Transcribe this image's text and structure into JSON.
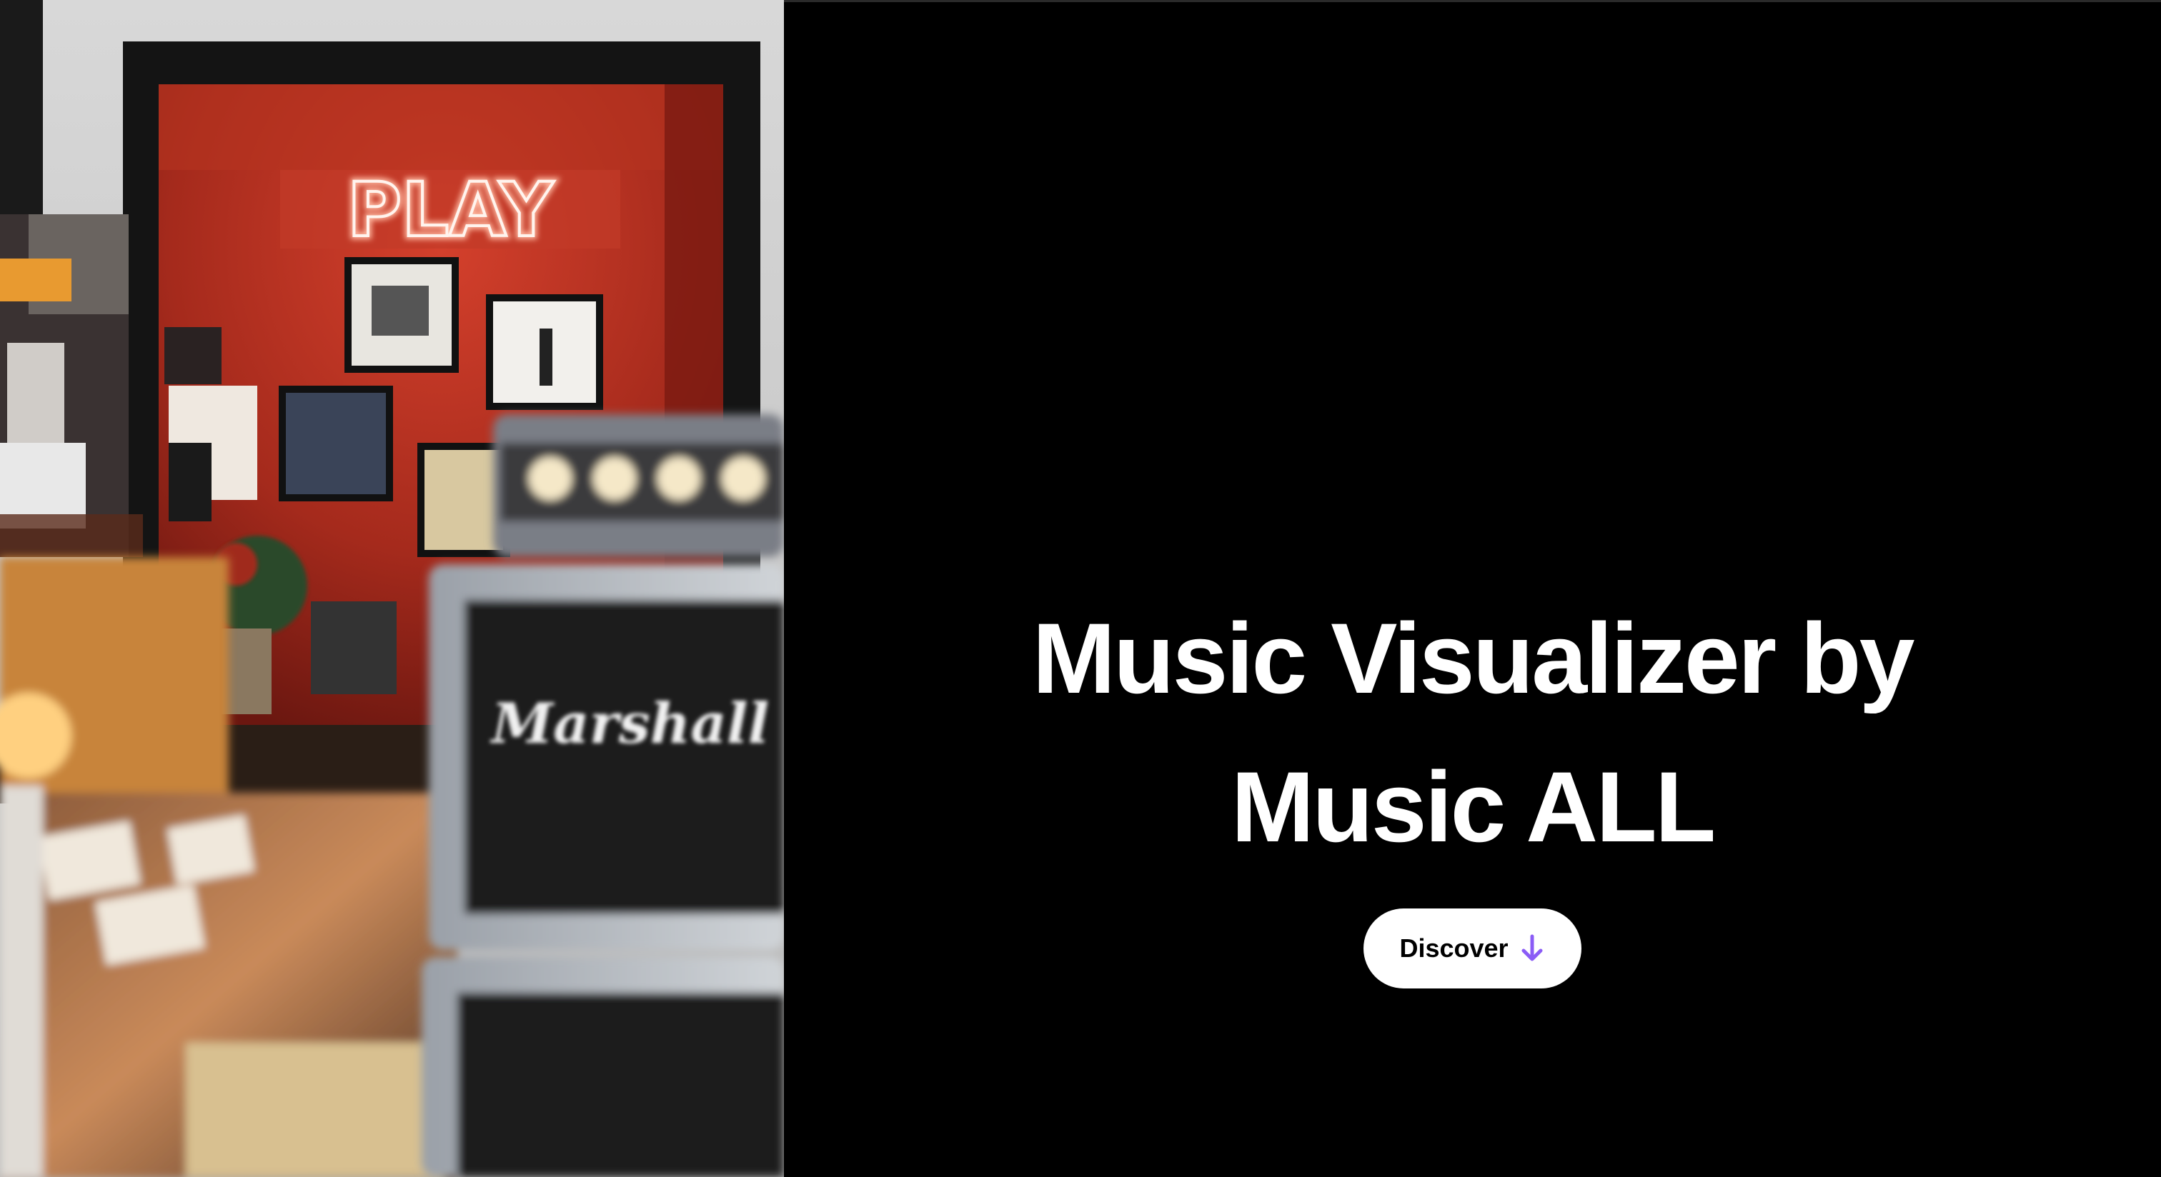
{
  "hero": {
    "title": "Music Visualizer by Music ALL",
    "cta_label": "Discover",
    "cta_icon": "arrow-down-icon",
    "accent_color": "#8b5cf6"
  },
  "photo": {
    "sign_text": "PLAY",
    "amp_logo": "Marshall"
  },
  "colors": {
    "background": "#000000",
    "title": "#ffffff",
    "button_bg": "#ffffff",
    "button_text": "#000000"
  }
}
